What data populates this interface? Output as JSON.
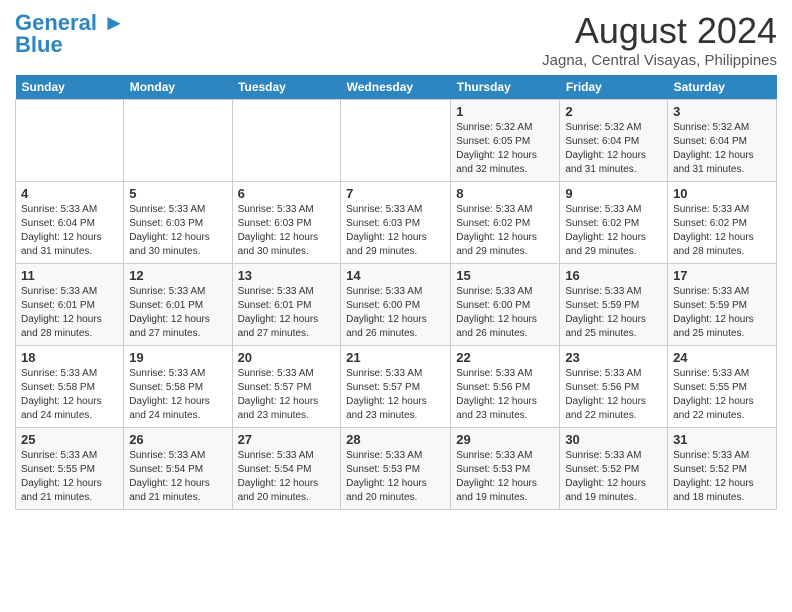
{
  "header": {
    "logo_line1": "General",
    "logo_line2": "Blue",
    "month_year": "August 2024",
    "location": "Jagna, Central Visayas, Philippines"
  },
  "columns": [
    "Sunday",
    "Monday",
    "Tuesday",
    "Wednesday",
    "Thursday",
    "Friday",
    "Saturday"
  ],
  "weeks": [
    [
      {
        "day": "",
        "info": ""
      },
      {
        "day": "",
        "info": ""
      },
      {
        "day": "",
        "info": ""
      },
      {
        "day": "",
        "info": ""
      },
      {
        "day": "1",
        "info": "Sunrise: 5:32 AM\nSunset: 6:05 PM\nDaylight: 12 hours\nand 32 minutes."
      },
      {
        "day": "2",
        "info": "Sunrise: 5:32 AM\nSunset: 6:04 PM\nDaylight: 12 hours\nand 31 minutes."
      },
      {
        "day": "3",
        "info": "Sunrise: 5:32 AM\nSunset: 6:04 PM\nDaylight: 12 hours\nand 31 minutes."
      }
    ],
    [
      {
        "day": "4",
        "info": "Sunrise: 5:33 AM\nSunset: 6:04 PM\nDaylight: 12 hours\nand 31 minutes."
      },
      {
        "day": "5",
        "info": "Sunrise: 5:33 AM\nSunset: 6:03 PM\nDaylight: 12 hours\nand 30 minutes."
      },
      {
        "day": "6",
        "info": "Sunrise: 5:33 AM\nSunset: 6:03 PM\nDaylight: 12 hours\nand 30 minutes."
      },
      {
        "day": "7",
        "info": "Sunrise: 5:33 AM\nSunset: 6:03 PM\nDaylight: 12 hours\nand 29 minutes."
      },
      {
        "day": "8",
        "info": "Sunrise: 5:33 AM\nSunset: 6:02 PM\nDaylight: 12 hours\nand 29 minutes."
      },
      {
        "day": "9",
        "info": "Sunrise: 5:33 AM\nSunset: 6:02 PM\nDaylight: 12 hours\nand 29 minutes."
      },
      {
        "day": "10",
        "info": "Sunrise: 5:33 AM\nSunset: 6:02 PM\nDaylight: 12 hours\nand 28 minutes."
      }
    ],
    [
      {
        "day": "11",
        "info": "Sunrise: 5:33 AM\nSunset: 6:01 PM\nDaylight: 12 hours\nand 28 minutes."
      },
      {
        "day": "12",
        "info": "Sunrise: 5:33 AM\nSunset: 6:01 PM\nDaylight: 12 hours\nand 27 minutes."
      },
      {
        "day": "13",
        "info": "Sunrise: 5:33 AM\nSunset: 6:01 PM\nDaylight: 12 hours\nand 27 minutes."
      },
      {
        "day": "14",
        "info": "Sunrise: 5:33 AM\nSunset: 6:00 PM\nDaylight: 12 hours\nand 26 minutes."
      },
      {
        "day": "15",
        "info": "Sunrise: 5:33 AM\nSunset: 6:00 PM\nDaylight: 12 hours\nand 26 minutes."
      },
      {
        "day": "16",
        "info": "Sunrise: 5:33 AM\nSunset: 5:59 PM\nDaylight: 12 hours\nand 25 minutes."
      },
      {
        "day": "17",
        "info": "Sunrise: 5:33 AM\nSunset: 5:59 PM\nDaylight: 12 hours\nand 25 minutes."
      }
    ],
    [
      {
        "day": "18",
        "info": "Sunrise: 5:33 AM\nSunset: 5:58 PM\nDaylight: 12 hours\nand 24 minutes."
      },
      {
        "day": "19",
        "info": "Sunrise: 5:33 AM\nSunset: 5:58 PM\nDaylight: 12 hours\nand 24 minutes."
      },
      {
        "day": "20",
        "info": "Sunrise: 5:33 AM\nSunset: 5:57 PM\nDaylight: 12 hours\nand 23 minutes."
      },
      {
        "day": "21",
        "info": "Sunrise: 5:33 AM\nSunset: 5:57 PM\nDaylight: 12 hours\nand 23 minutes."
      },
      {
        "day": "22",
        "info": "Sunrise: 5:33 AM\nSunset: 5:56 PM\nDaylight: 12 hours\nand 23 minutes."
      },
      {
        "day": "23",
        "info": "Sunrise: 5:33 AM\nSunset: 5:56 PM\nDaylight: 12 hours\nand 22 minutes."
      },
      {
        "day": "24",
        "info": "Sunrise: 5:33 AM\nSunset: 5:55 PM\nDaylight: 12 hours\nand 22 minutes."
      }
    ],
    [
      {
        "day": "25",
        "info": "Sunrise: 5:33 AM\nSunset: 5:55 PM\nDaylight: 12 hours\nand 21 minutes."
      },
      {
        "day": "26",
        "info": "Sunrise: 5:33 AM\nSunset: 5:54 PM\nDaylight: 12 hours\nand 21 minutes."
      },
      {
        "day": "27",
        "info": "Sunrise: 5:33 AM\nSunset: 5:54 PM\nDaylight: 12 hours\nand 20 minutes."
      },
      {
        "day": "28",
        "info": "Sunrise: 5:33 AM\nSunset: 5:53 PM\nDaylight: 12 hours\nand 20 minutes."
      },
      {
        "day": "29",
        "info": "Sunrise: 5:33 AM\nSunset: 5:53 PM\nDaylight: 12 hours\nand 19 minutes."
      },
      {
        "day": "30",
        "info": "Sunrise: 5:33 AM\nSunset: 5:52 PM\nDaylight: 12 hours\nand 19 minutes."
      },
      {
        "day": "31",
        "info": "Sunrise: 5:33 AM\nSunset: 5:52 PM\nDaylight: 12 hours\nand 18 minutes."
      }
    ]
  ]
}
